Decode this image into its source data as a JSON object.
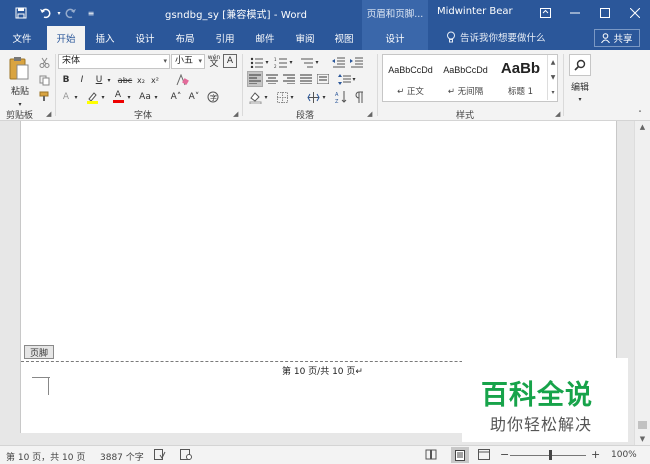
{
  "titlebar": {
    "doc_title": "gsndbg_sy [兼容模式] - Word",
    "context_group": "页眉和页脚...",
    "user_name": "Midwinter Bear",
    "icons": [
      "save-icon",
      "undo-icon",
      "redo-icon",
      "customize-qat-icon",
      "ribbon-display-icon",
      "minimize-icon",
      "restore-icon",
      "close-icon"
    ]
  },
  "tabs": [
    {
      "label": "文件",
      "active": false
    },
    {
      "label": "开始",
      "active": true
    },
    {
      "label": "插入",
      "active": false
    },
    {
      "label": "设计",
      "active": false
    },
    {
      "label": "布局",
      "active": false
    },
    {
      "label": "引用",
      "active": false
    },
    {
      "label": "邮件",
      "active": false
    },
    {
      "label": "审阅",
      "active": false
    },
    {
      "label": "视图",
      "active": false
    },
    {
      "label": "设计",
      "active": false
    }
  ],
  "tellme": "告诉我你想要做什么",
  "share": "共享",
  "ribbon": {
    "clipboard": {
      "paste": "粘贴",
      "label": "剪贴板"
    },
    "font": {
      "name": "宋体",
      "size": "小五",
      "label": "字体",
      "wen_label": "wén",
      "bold": "B",
      "italic": "I",
      "underline": "U",
      "strike": "abc",
      "sub": "x₂",
      "sup": "x²",
      "font_color_a": "A",
      "case": "Aa",
      "grow": "A˄",
      "shrink": "A˅",
      "char_border": "A"
    },
    "paragraph": {
      "label": "段落"
    },
    "styles": {
      "label": "样式",
      "items": [
        {
          "sample": "AaBbCcDd",
          "name": "↵ 正文"
        },
        {
          "sample": "AaBbCcDd",
          "name": "↵ 无间隔"
        },
        {
          "sample": "AaBb",
          "name": "标题 1"
        }
      ]
    },
    "editing": {
      "label": "编辑"
    }
  },
  "document": {
    "footer_tag": "页脚",
    "footer_text": "第 10 页/共 10 页↵"
  },
  "watermark": {
    "logo": "百科全说",
    "subtitle": "助你轻松解决"
  },
  "statusbar": {
    "page": "第 10 页，共 10 页",
    "words": "3887 个字",
    "zoom": "100%",
    "zoom_minus": "−",
    "zoom_plus": "+"
  }
}
